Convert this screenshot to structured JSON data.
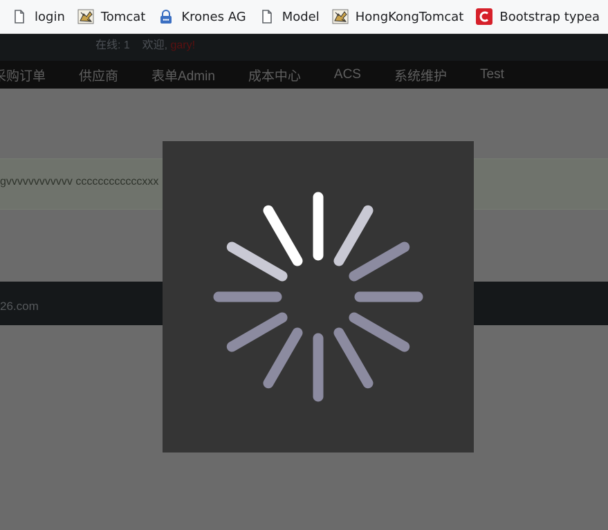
{
  "bookmarks": [
    {
      "label": "login",
      "icon": "page-icon"
    },
    {
      "label": "Tomcat",
      "icon": "tomcat-icon"
    },
    {
      "label": "Krones AG",
      "icon": "lock-icon"
    },
    {
      "label": "Model",
      "icon": "page-icon"
    },
    {
      "label": "HongKongTomcat",
      "icon": "tomcat-icon"
    },
    {
      "label": "Bootstrap typea",
      "icon": "brand-c-icon"
    }
  ],
  "topbar": {
    "online_label": "在线: 1",
    "welcome_label": "欢迎,",
    "username": "gary",
    "username_suffix": "!"
  },
  "nav": [
    "采购订单",
    "供应商",
    "表单Admin",
    "成本中心",
    "ACS",
    "系统维护",
    "Test"
  ],
  "alert": {
    "text": "gvvvvvvvvvvvv ccccccccccccxxx"
  },
  "footer": {
    "text": "26.com"
  },
  "loader": {
    "icon": "loading-spinner-icon",
    "colors": {
      "background": "#353535",
      "spoke_bright": "#ffffff",
      "spoke_dim": "#8c8ba0"
    }
  }
}
